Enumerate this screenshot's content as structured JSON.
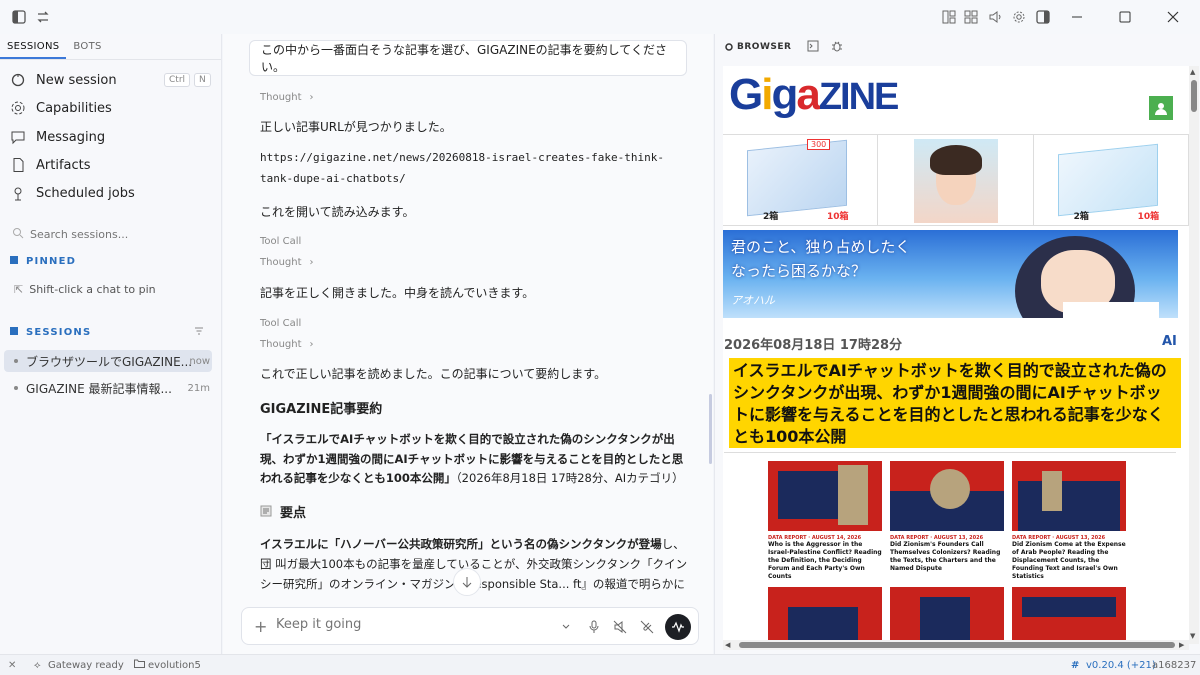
{
  "sidebar": {
    "tabs": [
      "SESSIONS",
      "BOTS"
    ],
    "nav": [
      {
        "label": "New session",
        "icon": "new-session-icon",
        "kbd": [
          "Ctrl",
          "N"
        ]
      },
      {
        "label": "Capabilities",
        "icon": "capabilities-icon"
      },
      {
        "label": "Messaging",
        "icon": "messaging-icon"
      },
      {
        "label": "Artifacts",
        "icon": "artifacts-icon"
      },
      {
        "label": "Scheduled jobs",
        "icon": "scheduled-jobs-icon"
      }
    ],
    "search_placeholder": "Search sessions...",
    "pinned_header": "PINNED",
    "pinned_hint": "Shift-click a chat to pin",
    "sessions_header": "SESSIONS",
    "sessions": [
      {
        "title": "ブラウザツールでGIGAZINE...",
        "time": "now"
      },
      {
        "title": "GIGAZINE 最新記事情報...",
        "time": "21m"
      }
    ]
  },
  "chat": {
    "prompt": "この中から一番面白そうな記事を選び、GIGAZINEの記事を要約してください。",
    "thought1": "Thought",
    "p1": "正しい記事URLが見つかりました。",
    "url": "https://gigazine.net/news/20260818-israel-creates-fake-think-tank-dupe-ai-chatbots/",
    "p2": "これを開いて読み込みます。",
    "toolcall1": "Tool Call",
    "thought2": "Thought",
    "p3": "記事を正しく開きました。中身を読んでいきます。",
    "toolcall2": "Tool Call",
    "thought3": "Thought",
    "p4": "これで正しい記事を読めました。この記事について要約します。",
    "summary_title": "GIGAZINE記事要約",
    "summary_quote": "「イスラエルでAIチャットボットを欺く目的で設立された偽のシンクタンクが出現、わずか1週間強の間にAIチャットボットに影響を与えることを目的としたと思われる記事を少なくとも100本公開」",
    "summary_meta": "（2026年8月18日 17時28分、AIカテゴリ）",
    "points_title": "要点",
    "points_body_bold": "イスラエルに「ハノーバー公共政策研究所」という名の偽シンクタンクが登場",
    "points_body": "し、団 叫ガ最大100本もの記事を量産していることが、外交政策シンクタンク「クインシー研究所」のオンライン・マガジン『Responsible Sta... ft』の報道で明らかになりました。",
    "composer_placeholder": "Keep it going"
  },
  "browser": {
    "label": "BROWSER",
    "site_logo": "GigaZINE",
    "ad_labels": [
      "300",
      "2箱",
      "10箱",
      "2箱",
      "10箱"
    ],
    "banner_text": [
      "君のこと、独り占めしたく",
      "なったら困るかな？"
    ],
    "banner_logo": "アオハル",
    "date": "2026年08月18日 17時28分",
    "category": "AI",
    "headline": "イスラエルでAIチャットボットを欺く目的で設立された偽のシンクタンクが出現、わずか1週間強の間にAIチャットボットに影響を与えることを目的としたと思われる記事を少なくとも100本公開",
    "tiles": [
      {
        "tag": "DATA REPORT · AUGUST 14, 2026",
        "title": "Who is the Aggressor in the Israel-Palestine Conflict? Reading the Definition, the Deciding Forum and Each Party's Own Counts"
      },
      {
        "tag": "DATA REPORT · AUGUST 13, 2026",
        "title": "Did Zionism's Founders Call Themselves Colonizers? Reading the Texts, the Charters and the Named Dispute"
      },
      {
        "tag": "DATA REPORT · AUGUST 13, 2026",
        "title": "Did Zionism Come at the Expense of Arab People? Reading the Displacement Counts, the Founding Text and Israel's Own Statistics"
      }
    ]
  },
  "status": {
    "gateway": "Gateway ready",
    "branch": "evolution5",
    "version": "v0.20.4 (+21)",
    "commit": "a168237"
  }
}
